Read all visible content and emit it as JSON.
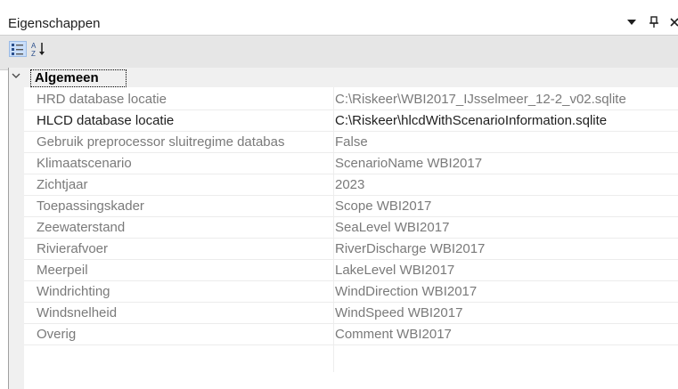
{
  "panel": {
    "title": "Eigenschappen",
    "dropdown_icon": "triangle-down",
    "pin_icon": "pin",
    "close_icon": "close"
  },
  "toolbar": {
    "categorized_icon": "categorized-view",
    "alphabetical_icon": "sort-alphabetical"
  },
  "category": {
    "label": "Algemeen",
    "expanded": true
  },
  "properties": [
    {
      "name": "HRD database locatie",
      "value": "C:\\Riskeer\\WBI2017_IJsselmeer_12-2_v02.sqlite",
      "editable": false
    },
    {
      "name": "HLCD database locatie",
      "value": "C:\\Riskeer\\hlcdWithScenarioInformation.sqlite",
      "editable": true
    },
    {
      "name": "Gebruik preprocessor sluitregime databas",
      "value": "False",
      "editable": false
    },
    {
      "name": "Klimaatscenario",
      "value": "ScenarioName WBI2017",
      "editable": false
    },
    {
      "name": "Zichtjaar",
      "value": "2023",
      "editable": false
    },
    {
      "name": "Toepassingskader",
      "value": "Scope WBI2017",
      "editable": false
    },
    {
      "name": "Zeewaterstand",
      "value": "SeaLevel WBI2017",
      "editable": false
    },
    {
      "name": "Rivierafvoer",
      "value": "RiverDischarge WBI2017",
      "editable": false
    },
    {
      "name": "Meerpeil",
      "value": "LakeLevel WBI2017",
      "editable": false
    },
    {
      "name": "Windrichting",
      "value": "WindDirection WBI2017",
      "editable": false
    },
    {
      "name": "Windsnelheid",
      "value": "WindSpeed WBI2017",
      "editable": false
    },
    {
      "name": "Overig",
      "value": "Comment WBI2017",
      "editable": false
    }
  ]
}
